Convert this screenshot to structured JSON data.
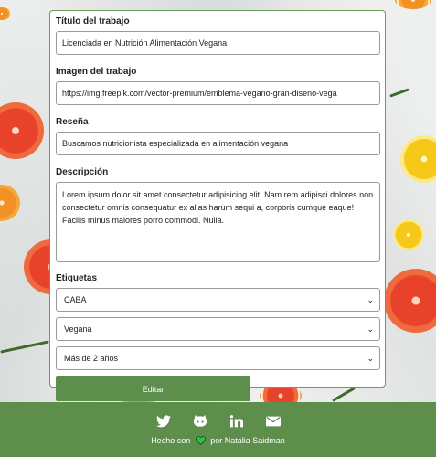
{
  "form": {
    "titulo": {
      "label": "Título del trabajo",
      "value": "Licenciada en Nutrición Alimentación Vegana"
    },
    "imagen": {
      "label": "Imagen del trabajo",
      "value": "https://img.freepik.com/vector-premium/emblema-vegano-gran-diseno-vega"
    },
    "resena": {
      "label": "Reseña",
      "value": "Buscamos nutricionista especializada en alimentación vegana"
    },
    "descripcion": {
      "label": "Descripción",
      "value": "Lorem ipsum dolor sit amet consectetur adipisicing elit. Nam rem adipisci dolores non consectetur omnis consequatur ex alias harum sequi a, corporis cumque eaque! Facilis minus maiores porro commodi. Nulla."
    },
    "etiquetas": {
      "label": "Etiquetas",
      "ubicacion": "CABA",
      "tipo": "Vegana",
      "experiencia": "Más de 2 años"
    },
    "submit_label": "Editar"
  },
  "footer": {
    "icons": [
      "twitter-icon",
      "github-icon",
      "linkedin-icon",
      "mail-icon"
    ],
    "credit_prefix": "Hecho con",
    "credit_suffix": "por Natalia Saidman",
    "heart_color": "#2fbf3a",
    "background": "#5e8e4c"
  }
}
